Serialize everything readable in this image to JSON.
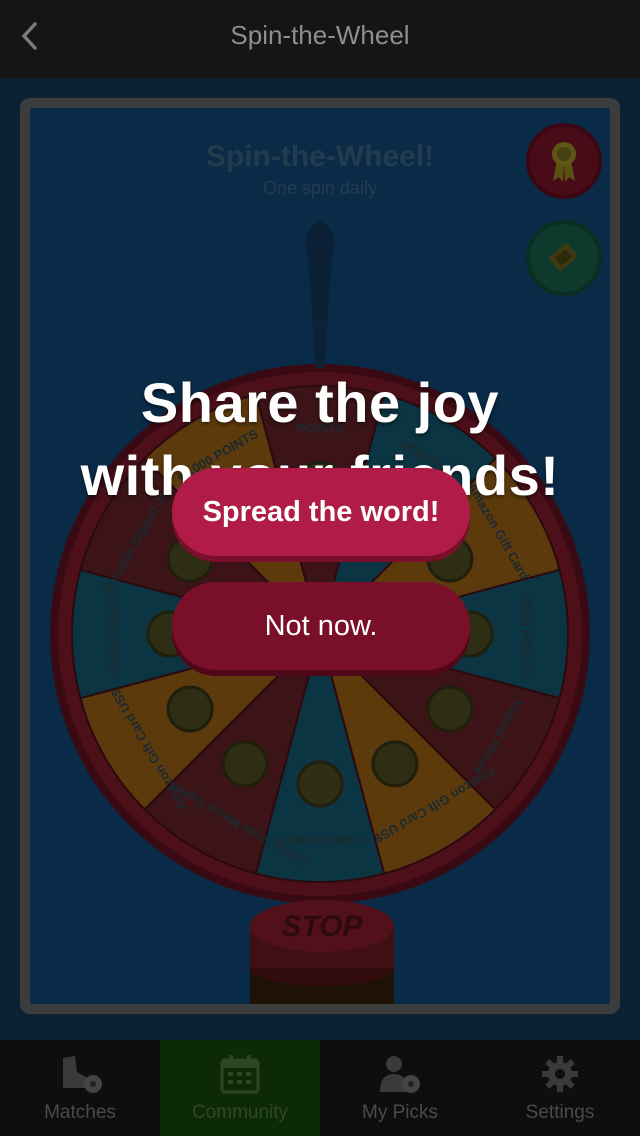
{
  "header": {
    "title": "Spin-the-Wheel",
    "back_icon": "chevron-left-icon"
  },
  "card": {
    "title": "Spin-the-Wheel!",
    "subtitle": "One spin daily"
  },
  "wheel": {
    "segments": [
      "POINTS",
      "POINTS",
      "Amazon Gift Card",
      "+3000 POINTS",
      "Xiaomi Phone",
      "Amazon Gift Card US$ 2.00",
      "+3000 POINTS",
      "Lucky Draw Messi Signed Jersey",
      "Amazon Gift Card US$ 5.00",
      "+3000 POINTS",
      "Ronaldo Signed Jersey",
      "+8,000 POINTS"
    ]
  },
  "stop_button": {
    "label": "STOP"
  },
  "modal": {
    "line1": "Share the joy",
    "line2": "with your friends!",
    "primary_label": "Spread the word!",
    "secondary_label": "Not now."
  },
  "tabs": [
    {
      "label": "Matches",
      "icon": "soccer-shoe-icon"
    },
    {
      "label": "Community",
      "icon": "calendar-icon"
    },
    {
      "label": "My Picks",
      "icon": "user-ball-icon"
    },
    {
      "label": "Settings",
      "icon": "gear-icon"
    }
  ],
  "colors": {
    "accent": "#b01c47",
    "active_tab": "#0c2a07"
  }
}
